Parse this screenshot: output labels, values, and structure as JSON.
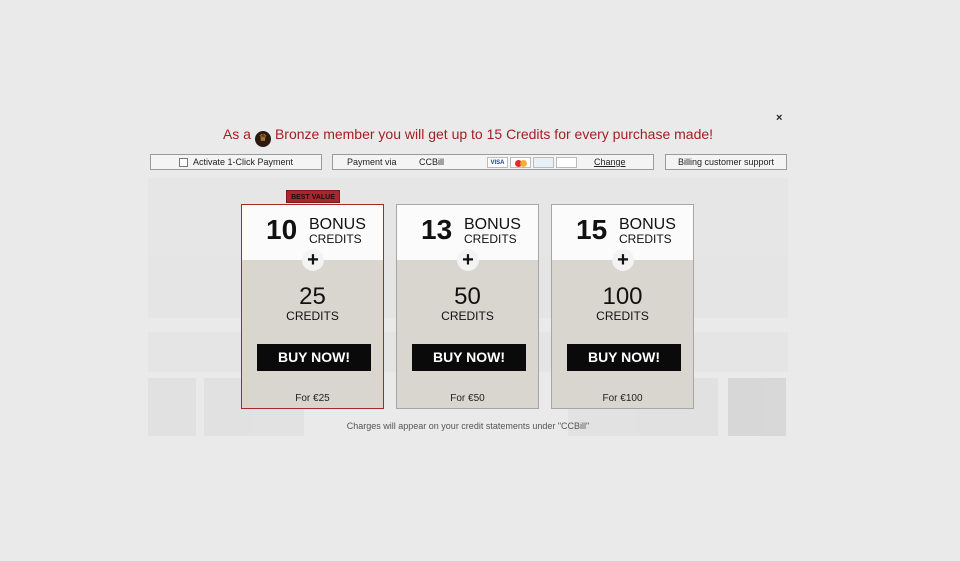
{
  "promo": {
    "prefix": "As a",
    "suffix": "Bronze member you will get up to 15 Credits for every purchase made!",
    "medal_icon": "bronze-medal-icon"
  },
  "close_label": "×",
  "payment_bar": {
    "one_click_label": "Activate 1-Click Payment",
    "payment_via_label": "Payment via",
    "processor": "CCBill",
    "cards": [
      "VISA",
      "MC",
      "Diners",
      "DISCOVER"
    ],
    "change_label": "Change",
    "support_label": "Billing customer support"
  },
  "packages": [
    {
      "bonus": "10",
      "bonus_word": "BONUS",
      "bonus_sub": "CREDITS",
      "plus": "+",
      "credits": "25",
      "credits_word": "CREDITS",
      "buy_label": "BUY NOW!",
      "price": "For €25",
      "badge": "BEST VALUE"
    },
    {
      "bonus": "13",
      "bonus_word": "BONUS",
      "bonus_sub": "CREDITS",
      "plus": "+",
      "credits": "50",
      "credits_word": "CREDITS",
      "buy_label": "BUY NOW!",
      "price": "For €50"
    },
    {
      "bonus": "15",
      "bonus_word": "BONUS",
      "bonus_sub": "CREDITS",
      "plus": "+",
      "credits": "100",
      "credits_word": "CREDITS",
      "buy_label": "BUY NOW!",
      "price": "For €100"
    }
  ],
  "footnote": "Charges will appear on your credit statements under \"CCBill\"",
  "colors": {
    "accent": "#a61e22",
    "button": "#0a0a0a",
    "card_bottom": "#d9d6d0"
  }
}
